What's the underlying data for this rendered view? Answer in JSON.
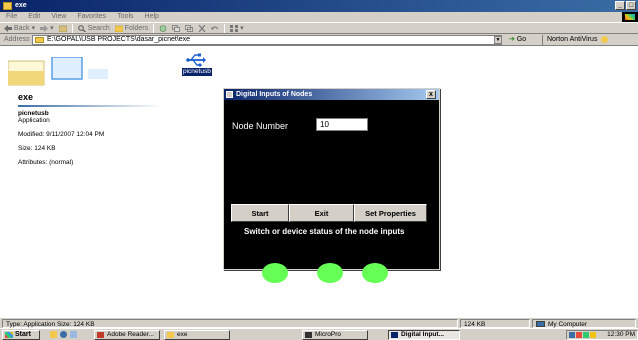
{
  "window": {
    "title": "exe"
  },
  "menu": [
    "File",
    "Edit",
    "View",
    "Favorites",
    "Tools",
    "Help"
  ],
  "toolbar": {
    "back": "Back",
    "search": "Search",
    "folders": "Folders"
  },
  "address": {
    "label": "Address",
    "path": "E:\\GOPAL\\USB PROJECTS\\dasar_picnet\\exe",
    "go": "Go",
    "norton": "Norton AntiVirus"
  },
  "details": {
    "folder_title": "exe",
    "file_name": "picnetusb",
    "file_type": "Application",
    "modified": "Modified: 9/11/2007 12:04 PM",
    "size": "Size: 124 KB",
    "attributes": "Attributes: (normal)"
  },
  "file_item": {
    "label": "picnetusb"
  },
  "dialog": {
    "title": "Digital Inputs of Nodes",
    "close": "x",
    "node_label": "Node Number",
    "node_value": "10",
    "buttons": {
      "start": "Start",
      "exit": "Exit",
      "set_properties": "Set Properties"
    },
    "status_text": "Switch or device status of the node inputs",
    "leds": [
      {
        "name": "input-1",
        "color": "#66ff55"
      },
      {
        "name": "input-2",
        "color": "#66ff55"
      },
      {
        "name": "input-3",
        "color": "#66ff55"
      }
    ]
  },
  "statusbar": {
    "left": "Type: Application Size: 124 KB",
    "size": "124 KB",
    "zone": "My Computer"
  },
  "taskbar": {
    "start": "Start",
    "tasks": [
      {
        "label": "Adobe Reader...",
        "active": false
      },
      {
        "label": "exe",
        "active": false
      },
      {
        "label": "MicroPro",
        "active": false
      },
      {
        "label": "Digital Input...",
        "active": true
      }
    ],
    "clock": "12:30 PM"
  },
  "colors": {
    "titlebar": "#0a246a",
    "dialog_bg": "#000000",
    "led": "#66ff55",
    "chrome": "#d4d0c8"
  }
}
